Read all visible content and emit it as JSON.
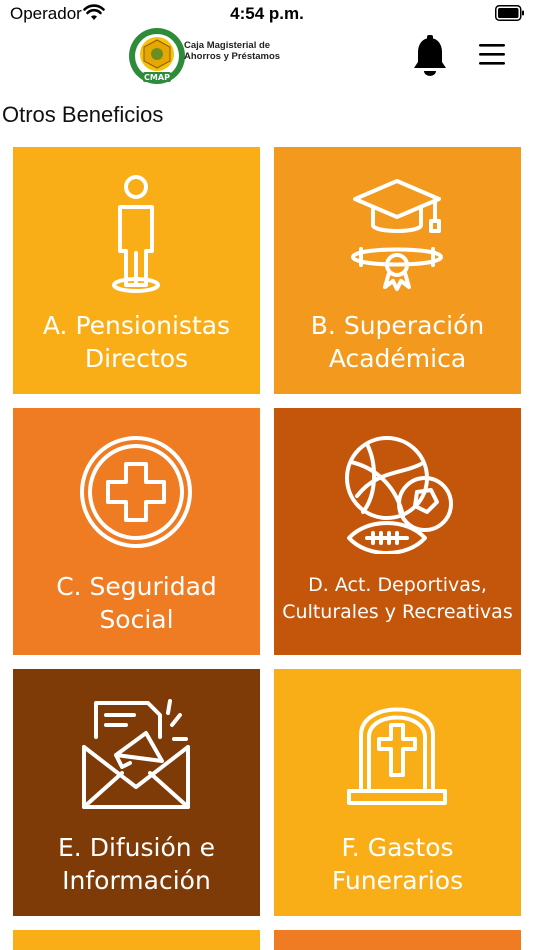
{
  "status_bar": {
    "carrier": "Operador",
    "time": "4:54 p.m."
  },
  "header": {
    "logo_text_line1": "Caja Magisterial de",
    "logo_text_line2": "Ahorros y Préstamos",
    "logo_badge": "CMAP"
  },
  "section": {
    "title": "Otros Beneficios"
  },
  "tiles": [
    {
      "label": "A. Pensionistas\nDirectos",
      "color": "#F9AE18",
      "icon": "person-icon"
    },
    {
      "label": "B. Superación\nAcadémica",
      "color": "#F39A1E",
      "icon": "graduation-icon"
    },
    {
      "label": "C. Seguridad\nSocial",
      "color": "#EF7B22",
      "icon": "medical-cross-icon"
    },
    {
      "label": "D. Act. Deportivas,\nCulturales y Recreativas",
      "color": "#C4560C",
      "icon": "sports-balls-icon"
    },
    {
      "label": "E. Difusión e\nInformación",
      "color": "#7E3A07",
      "icon": "megaphone-envelope-icon"
    },
    {
      "label": "F. Gastos\nFunerarios",
      "color": "#F9AE18",
      "icon": "tombstone-icon"
    }
  ],
  "colors": {
    "tile_partial_left": "#F9AE18",
    "tile_partial_right": "#EF7B22",
    "logo_green": "#2E8B3A"
  }
}
